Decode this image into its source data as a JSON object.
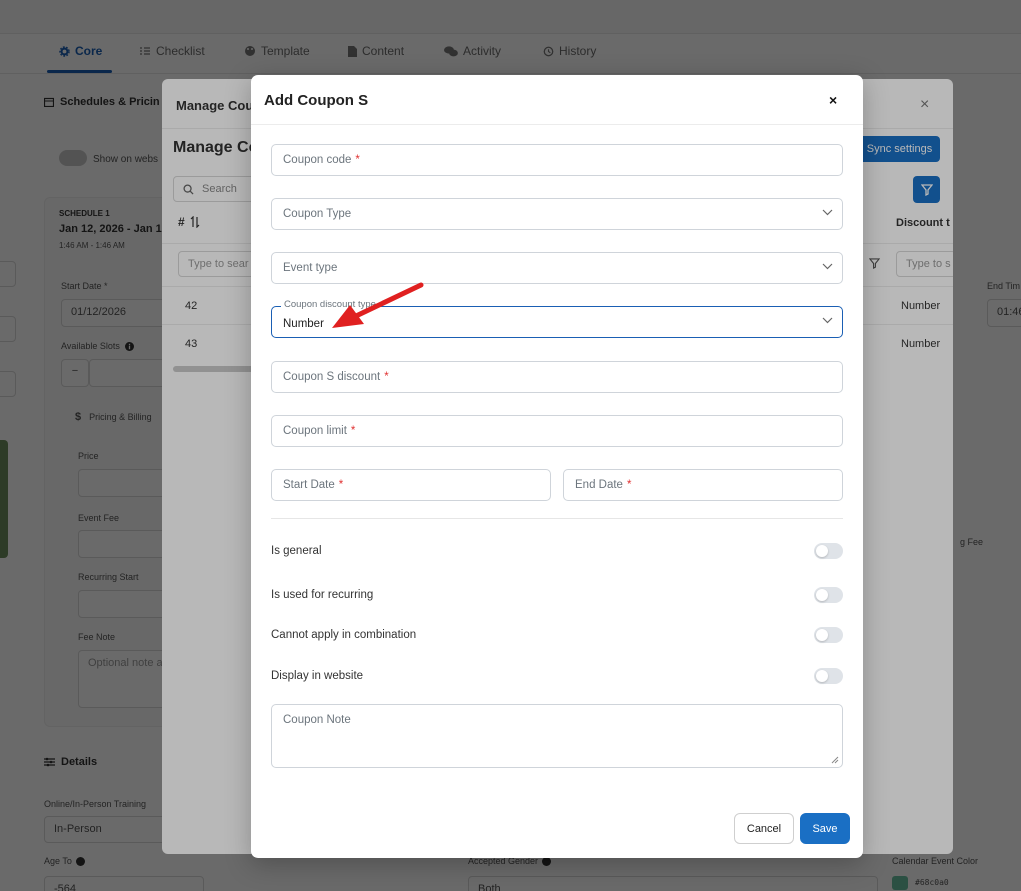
{
  "tabs": [
    {
      "label": "Core",
      "active": true
    },
    {
      "label": "Checklist"
    },
    {
      "label": "Template"
    },
    {
      "label": "Content"
    },
    {
      "label": "Activity"
    },
    {
      "label": "History"
    }
  ],
  "background": {
    "schedules_title": "Schedules & Pricin",
    "show_on_website": "Show on webs",
    "schedule_label": "SCHEDULE 1",
    "schedule_dates": "Jan 12, 2026 - Jan 1",
    "schedule_times": "1:46 AM - 1:46 AM",
    "start_date_label": "Start Date *",
    "start_date_value": "01/12/2026",
    "available_slots_label": "Available Slots",
    "stepper_minus": "−",
    "pricing_title": "Pricing & Billing",
    "price_label": "Price",
    "event_fee_label": "Event Fee",
    "recurring_start_label": "Recurring Start",
    "fee_note_label": "Fee Note",
    "fee_note_placeholder": "Optional note a",
    "details_title": "Details",
    "online_label": "Online/In-Person Training",
    "online_value": "In-Person",
    "age_to_label": "Age To",
    "age_to_value": "-564",
    "accepted_gender_label": "Accepted Gender",
    "accepted_gender_value": "Both",
    "calendar_color_label": "Calendar Event Color",
    "calendar_color_value": "#68c0a0",
    "end_time_label": "End Tim",
    "end_time_value": "01:46",
    "g_fee_label": "g Fee"
  },
  "manage_modal": {
    "header_title": "Manage Cou",
    "section_title": "Manage Co",
    "sync_button": "Sync settings",
    "search_placeholder": "Search",
    "col_number": "#",
    "col_discount_type": "Discount t",
    "filter_placeholder": "Type to sear",
    "filter_placeholder_right": "Type to s",
    "rows": [
      {
        "id": "42",
        "discount_type": "Number"
      },
      {
        "id": "43",
        "discount_type": "Number"
      }
    ]
  },
  "coupon_modal": {
    "title": "Add Coupon S",
    "close_label": "×",
    "fields": {
      "coupon_code": {
        "placeholder": "Coupon code",
        "required": "*"
      },
      "coupon_type": {
        "placeholder": "Coupon Type"
      },
      "event_type": {
        "placeholder": "Event type"
      },
      "discount_type": {
        "label": "Coupon discount type",
        "value": "Number"
      },
      "coupon_discount": {
        "placeholder": "Coupon S discount",
        "required": "*"
      },
      "coupon_limit": {
        "placeholder": "Coupon limit",
        "required": "*"
      },
      "start_date": {
        "placeholder": "Start Date",
        "required": "*"
      },
      "end_date": {
        "placeholder": "End Date",
        "required": "*"
      }
    },
    "toggles": [
      {
        "label": "Is general",
        "on": false
      },
      {
        "label": "Is used for recurring",
        "on": false
      },
      {
        "label": "Cannot apply in combination",
        "on": false
      },
      {
        "label": "Display in website",
        "on": false
      }
    ],
    "note_placeholder": "Coupon Note",
    "cancel_label": "Cancel",
    "save_label": "Save"
  },
  "colors": {
    "accent": "#1a6fc4",
    "required": "#e03131",
    "annotation_arrow": "#e02020",
    "calendar_swatch": "#68c0a0"
  }
}
